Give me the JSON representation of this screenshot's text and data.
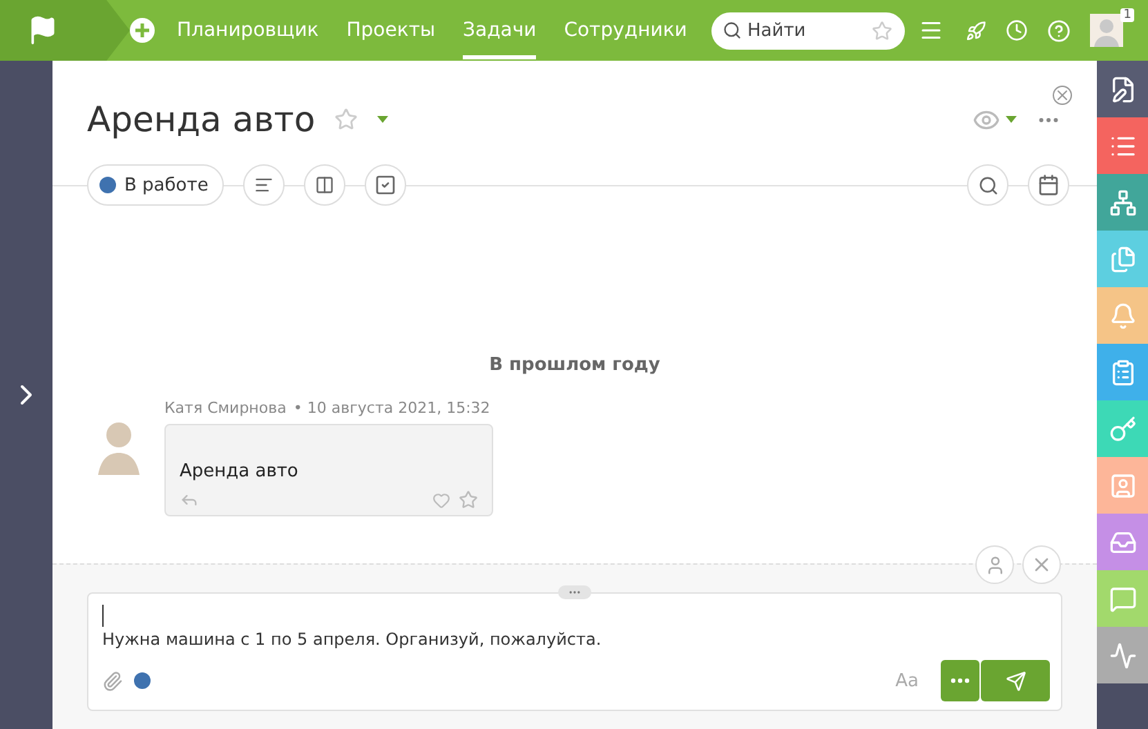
{
  "nav": {
    "items": [
      {
        "label": "Планировщик",
        "selected": false
      },
      {
        "label": "Проекты",
        "selected": false
      },
      {
        "label": "Задачи",
        "selected": true
      },
      {
        "label": "Сотрудники",
        "selected": false
      }
    ],
    "search": {
      "placeholder": "Найти"
    },
    "notification_count": "1"
  },
  "task": {
    "title": "Аренда авто",
    "favorite": false,
    "status": {
      "label": "В работе",
      "color": "#3f72af"
    }
  },
  "feed": {
    "divider": "В прошлом году",
    "messages": [
      {
        "author": "Катя Смирнова",
        "time": "• 10 августа 2021, 15:32",
        "text": "Аренда авто",
        "liked": false,
        "favorite": false
      }
    ]
  },
  "composer": {
    "value": "Нужна машина с 1 по 5 апреля. Организуй, пожалуйста.",
    "format_label": "Aa",
    "color": "#3f72af"
  },
  "rail": [
    {
      "kind": "note",
      "color": "#585c72"
    },
    {
      "kind": "list",
      "color": "#f4645f"
    },
    {
      "kind": "tree",
      "color": "#41a69a"
    },
    {
      "kind": "files",
      "color": "#5dcfe0"
    },
    {
      "kind": "bell",
      "color": "#f5c487"
    },
    {
      "kind": "clipboard",
      "color": "#3fb0ea"
    },
    {
      "kind": "key",
      "color": "#3dd9b6"
    },
    {
      "kind": "contact",
      "color": "#fdb699"
    },
    {
      "kind": "inbox",
      "color": "#c58fe6"
    },
    {
      "kind": "chat",
      "color": "#a2d96c"
    },
    {
      "kind": "wave",
      "color": "#ababab"
    }
  ]
}
